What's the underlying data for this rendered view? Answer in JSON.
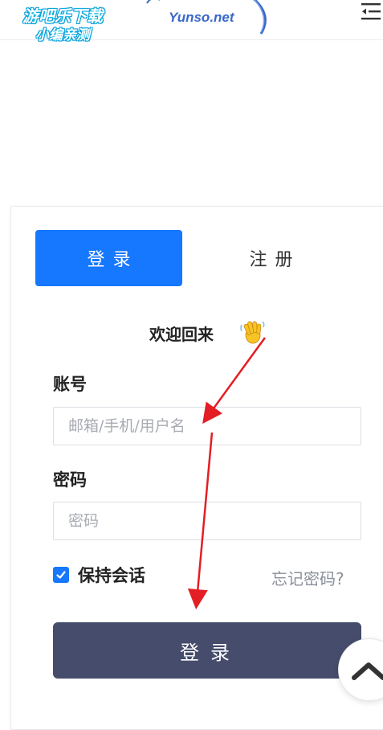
{
  "watermark": {
    "line1": "游吧乐下载",
    "line2": "小编亲测"
  },
  "header": {
    "logo_text": "Yunso.net",
    "menu_icon": "menu-indent-icon"
  },
  "tabs": {
    "login": "登录",
    "register": "注册",
    "active": "login"
  },
  "welcome": {
    "text": "欢迎回来",
    "icon": "waving-hand-icon"
  },
  "form": {
    "account_label": "账号",
    "account_placeholder": "邮箱/手机/用户名",
    "account_value": "",
    "password_label": "密码",
    "password_placeholder": "密码",
    "password_value": "",
    "remember_label": "保持会话",
    "remember_checked": true,
    "forgot_link": "忘记密码?",
    "submit_label": "登录"
  },
  "floating": {
    "back_to_top_icon": "chevron-up-icon"
  },
  "colors": {
    "primary": "#1677ff",
    "submit": "#464c6b",
    "annotation": "#e31e24"
  }
}
